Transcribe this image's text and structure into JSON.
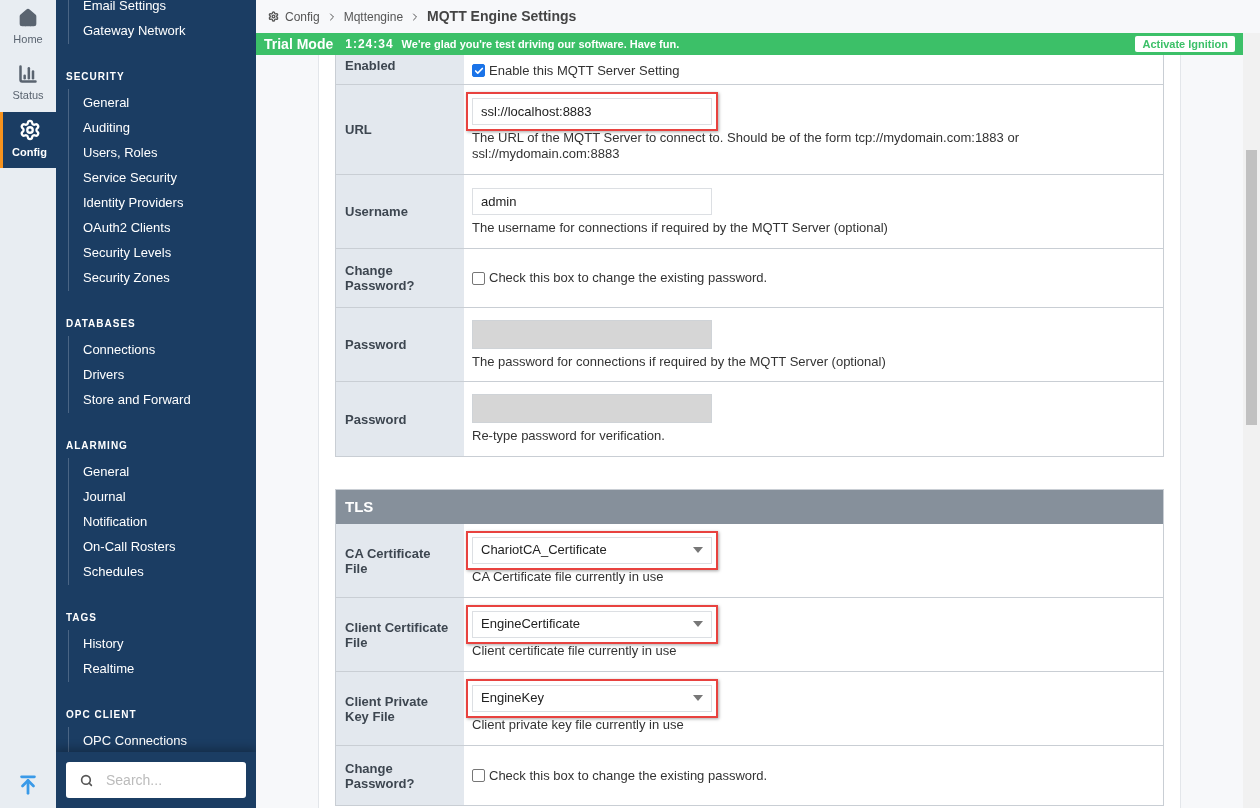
{
  "nav_rail": [
    {
      "label": "Home",
      "selected": false
    },
    {
      "label": "Status",
      "selected": false
    },
    {
      "label": "Config",
      "selected": true
    }
  ],
  "sidebar": {
    "sections": [
      {
        "items": [
          "Email Settings",
          "Gateway Network"
        ]
      },
      {
        "heading": "SECURITY",
        "items": [
          "General",
          "Auditing",
          "Users, Roles",
          "Service Security",
          "Identity Providers",
          "OAuth2 Clients",
          "Security Levels",
          "Security Zones"
        ]
      },
      {
        "heading": "DATABASES",
        "items": [
          "Connections",
          "Drivers",
          "Store and Forward"
        ]
      },
      {
        "heading": "ALARMING",
        "items": [
          "General",
          "Journal",
          "Notification",
          "On-Call Rosters",
          "Schedules"
        ]
      },
      {
        "heading": "TAGS",
        "items": [
          "History",
          "Realtime"
        ]
      },
      {
        "heading": "OPC CLIENT",
        "items": [
          "OPC Connections"
        ]
      }
    ],
    "search": {
      "placeholder": "Search..."
    }
  },
  "breadcrumb": [
    "Config",
    "Mqttengine",
    "MQTT Engine Settings"
  ],
  "trial_bar": {
    "title": "Trial Mode",
    "time": "1:24:34",
    "message": "We're glad you're test driving our software. Have fun.",
    "button": "Activate Ignition"
  },
  "sections": [
    {
      "rows": [
        {
          "kind": "checkbox",
          "label": "Enabled",
          "text": "Enable this MQTT Server Setting",
          "checked": true,
          "highlighted": false
        },
        {
          "kind": "text",
          "label": "URL",
          "value": "ssl://localhost:8883",
          "help": "The URL of the MQTT Server to connect to. Should be of the form tcp://mydomain.com:1883 or ssl://mydomain.com:8883",
          "highlighted": true
        },
        {
          "kind": "text",
          "label": "Username",
          "value": "admin",
          "help": "The username for connections if required by the MQTT Server (optional)",
          "highlighted": false
        },
        {
          "kind": "checkbox",
          "label": "Change Password?",
          "text": "Check this box to change the existing password.",
          "checked": false,
          "highlighted": false
        },
        {
          "kind": "password",
          "label": "Password",
          "help": "The password for connections if required by the MQTT Server (optional)",
          "disabled": true,
          "highlighted": false
        },
        {
          "kind": "password",
          "label": "Password",
          "help": "Re-type password for verification.",
          "disabled": true,
          "highlighted": false
        }
      ]
    },
    {
      "title": "TLS",
      "rows": [
        {
          "kind": "select",
          "label": "CA Certificate File",
          "value": "ChariotCA_Certificate",
          "help": "CA Certificate file currently in use",
          "highlighted": true
        },
        {
          "kind": "select",
          "label": "Client Certificate File",
          "value": "EngineCertificate",
          "help": "Client certificate file currently in use",
          "highlighted": true
        },
        {
          "kind": "select",
          "label": "Client Private Key File",
          "value": "EngineKey",
          "help": "Client private key file currently in use",
          "highlighted": true
        },
        {
          "kind": "checkbox",
          "label": "Change Password?",
          "text": "Check this box to change the existing password.",
          "checked": false,
          "highlighted": false
        }
      ]
    }
  ]
}
